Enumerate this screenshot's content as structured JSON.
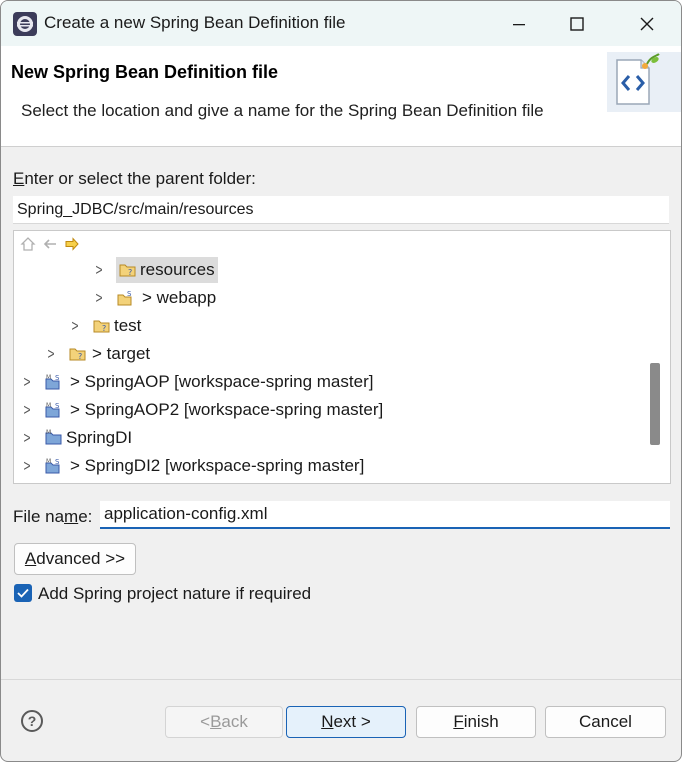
{
  "window": {
    "title": "Create a new Spring Bean Definition file",
    "minimize": "—",
    "maximize": "☐",
    "close": "✕"
  },
  "banner": {
    "title": "New Spring Bean Definition file",
    "description": "Select the location and give a name for the Spring Bean Definition file"
  },
  "parent_folder": {
    "label_prefix": "E",
    "label_rest": "nter or select the parent folder:",
    "value": "Spring_JDBC/src/main/resources"
  },
  "tree": {
    "items": [
      {
        "label": "resources",
        "selected": true
      },
      {
        "label": "> webapp",
        "selected": false
      },
      {
        "label": "test",
        "selected": false
      },
      {
        "label": "> target",
        "selected": false
      },
      {
        "label": "> SpringAOP [workspace-spring master]",
        "selected": false
      },
      {
        "label": "> SpringAOP2 [workspace-spring master]",
        "selected": false
      },
      {
        "label": "SpringDI",
        "selected": false
      },
      {
        "label": "> SpringDI2 [workspace-spring master]",
        "selected": false
      }
    ]
  },
  "file_name": {
    "label_a": "File na",
    "label_m": "m",
    "label_b": "e:",
    "value": "application-config.xml"
  },
  "advanced": {
    "label_a": "A",
    "label_b": "dvanced >>"
  },
  "nature": {
    "label": "Add Spring project nature if required",
    "checked": true
  },
  "footer": {
    "back_a": "< ",
    "back_u": "B",
    "back_b": "ack",
    "next_u": "N",
    "next_b": "ext >",
    "finish_u": "F",
    "finish_b": "inish",
    "cancel": "Cancel"
  },
  "colors": {
    "accent": "#1a63b5",
    "selection": "#dcdcdc",
    "titlebar": "#eef6f6"
  }
}
